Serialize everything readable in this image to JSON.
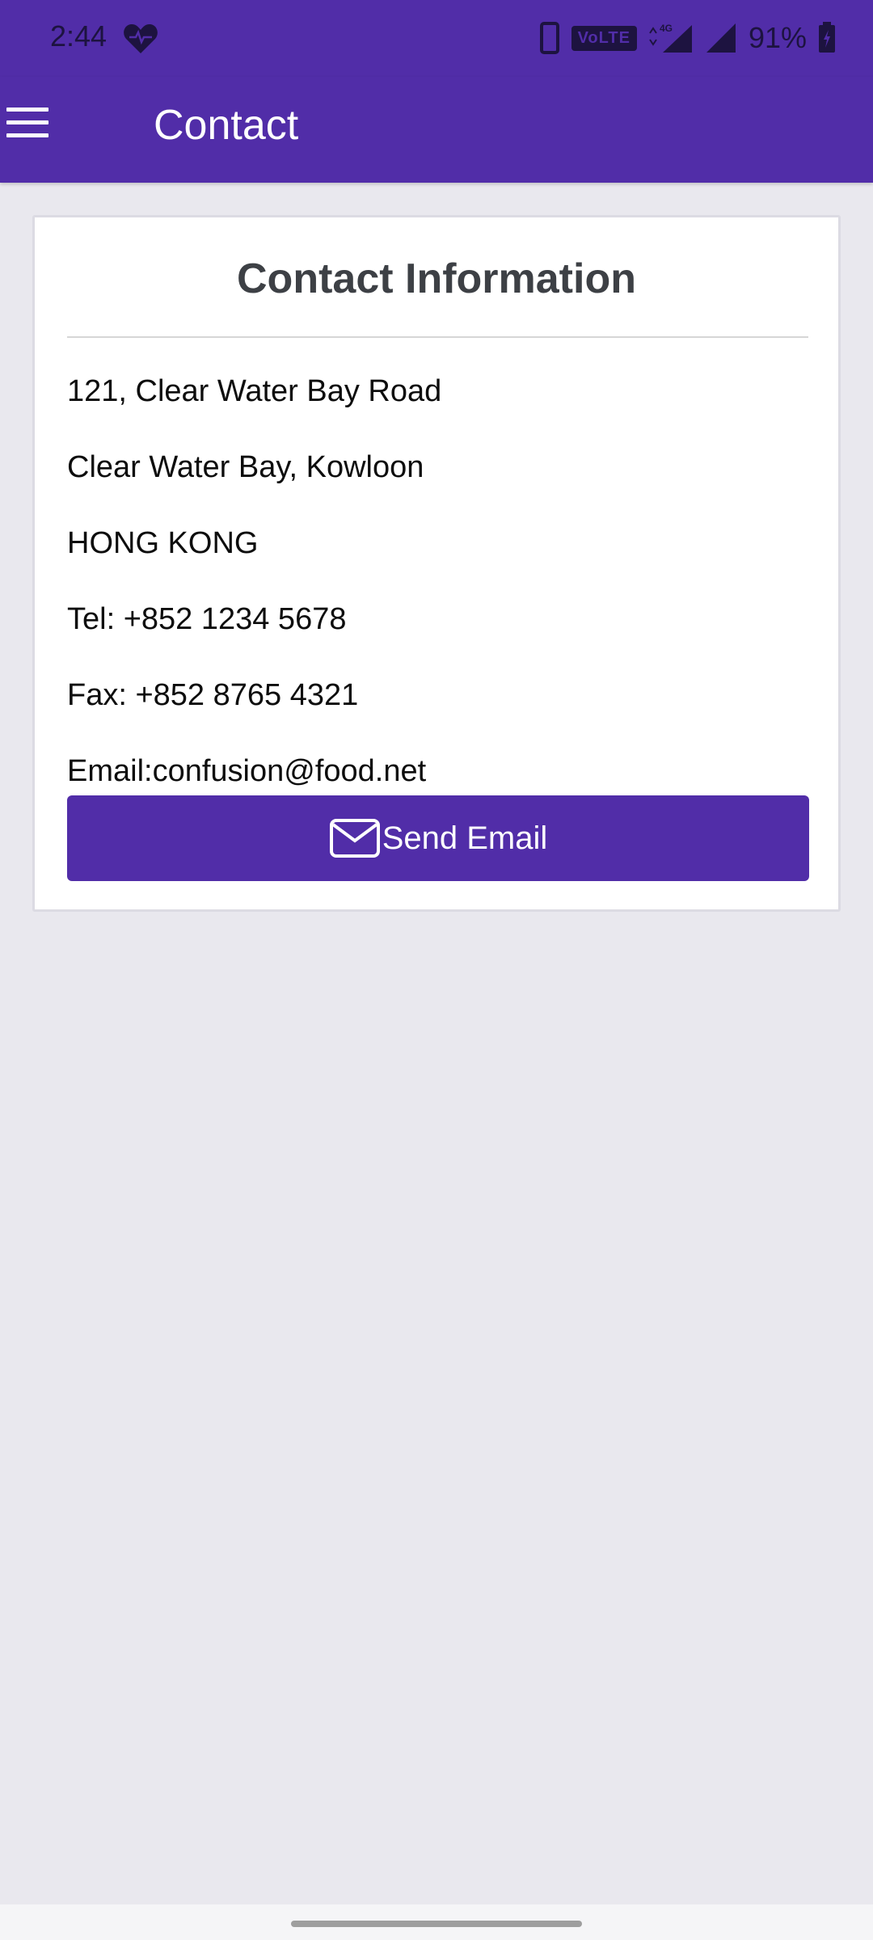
{
  "status_bar": {
    "time": "2:44",
    "volte": "VoLTE",
    "network": "4G",
    "battery": "91%"
  },
  "app_bar": {
    "title": "Contact"
  },
  "card": {
    "title": "Contact Information",
    "lines": [
      "121, Clear Water Bay Road",
      "Clear Water Bay, Kowloon",
      "HONG KONG",
      "Tel: +852 1234 5678",
      "Fax: +852 8765 4321",
      "Email:confusion@food.net"
    ],
    "button_label": "Send Email"
  },
  "colors": {
    "primary": "#512da8",
    "background": "#e9e8ee",
    "card": "#ffffff",
    "title_text": "#3d4045"
  },
  "icons": [
    "heart-icon",
    "phone-icon",
    "signal-icon",
    "battery-icon",
    "menu-icon",
    "mail-icon"
  ]
}
